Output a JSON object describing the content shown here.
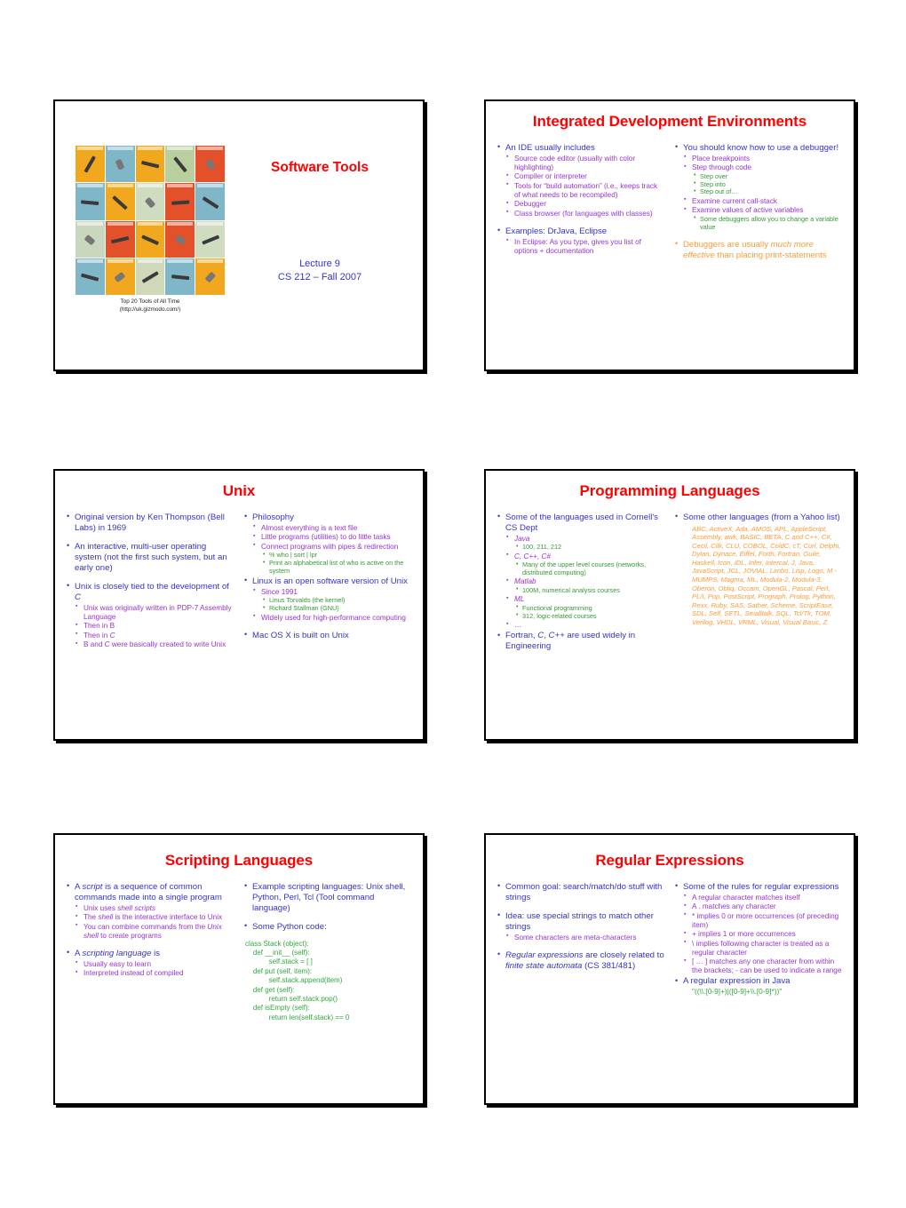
{
  "document": {
    "type": "lecture-slide-handout",
    "slide_count": 6
  },
  "colors": {
    "title_red": "#ff0000",
    "level1_blue": "#3333cc",
    "level2_purple": "#9933cc",
    "level3_green": "#339933",
    "accent_orange": "#ff9933",
    "code_green": "#2eaa3c",
    "border_black": "#000000"
  },
  "slides": [
    {
      "id": "slide-title",
      "title": "Software Tools",
      "subtitle_lines": [
        "Lecture 9",
        "CS 212 – Fall 2007"
      ],
      "image_caption_lines": [
        "Top 20 Tools of All Time",
        "(http://uk.gizmodo.com/)"
      ],
      "image_alt": "Top 20 Tools of All Time collage, 5 by 4 grid of tool illustrations",
      "tool_grid": {
        "rows": 4,
        "cols": 5,
        "cell_colors": [
          "#f2a81e",
          "#7fb7c9",
          "#f2a81e",
          "#b9cf9e",
          "#e4502a",
          "#7fb7c9",
          "#f2a81e",
          "#cfdcc0",
          "#e4502a",
          "#7fb7c9",
          "#c9d7bf",
          "#e4502a",
          "#f2a81e",
          "#e4502a",
          "#cfdcc0",
          "#7fb7c9",
          "#f2a81e",
          "#cfd8b8",
          "#7fb7c9",
          "#f2a81e"
        ]
      }
    },
    {
      "id": "slide-ide",
      "title": "Integrated Development Environments",
      "left_column": [
        {
          "level": 1,
          "text": "An IDE usually includes",
          "children": [
            {
              "level": 2,
              "text": "Source code editor (usually with color highlighting)"
            },
            {
              "level": 2,
              "text": "Compiler or interpreter"
            },
            {
              "level": 2,
              "text": "Tools for “build automation” (i.e., keeps track of what needs to be recompiled)"
            },
            {
              "level": 2,
              "text": "Debugger"
            },
            {
              "level": 2,
              "text": "Class browser (for languages with classes)"
            }
          ]
        },
        {
          "level": 1,
          "spaced": true,
          "text": "Examples: DrJava, Eclipse",
          "children": [
            {
              "level": 2,
              "text": "In Eclipse: As you type, gives you list of options + documentation"
            }
          ]
        }
      ],
      "right_column": [
        {
          "level": 1,
          "text": "You should know how to use a debugger!",
          "children": [
            {
              "level": 2,
              "text": "Place breakpoints"
            },
            {
              "level": 2,
              "text": "Step through code",
              "children": [
                {
                  "level": 3,
                  "text": "Step over"
                },
                {
                  "level": 3,
                  "text": "Step into"
                },
                {
                  "level": 3,
                  "text": "Step out of…"
                }
              ]
            },
            {
              "level": 2,
              "text": "Examine current call-stack"
            },
            {
              "level": 2,
              "text": "Examine values of active variables",
              "children": [
                {
                  "level": 3,
                  "text": "Some debuggers allow you to change a variable value"
                }
              ]
            }
          ]
        },
        {
          "level": 1,
          "spaced": true,
          "orange": true,
          "html": "Debuggers are usually <i>much more effective</i> than placing print-statements",
          "text": "Debuggers are usually much more effective than placing print-statements"
        }
      ]
    },
    {
      "id": "slide-unix",
      "title": "Unix",
      "left_column": [
        {
          "level": 1,
          "text": "Original version by Ken Thompson (Bell Labs) in 1969"
        },
        {
          "level": 1,
          "spaced": true,
          "text": "An interactive, multi-user operating system (not the first such system, but an early one)"
        },
        {
          "level": 1,
          "spaced": true,
          "html": "Unix is closely tied to the development of <i>C</i>",
          "text": "Unix is closely tied to the development of C",
          "children": [
            {
              "level": 2,
              "text": "Unix was originally written in PDP-7 Assembly Language"
            },
            {
              "level": 2,
              "text": "Then in B"
            },
            {
              "level": 2,
              "html": "Then in <i>C</i>",
              "text": "Then in C"
            },
            {
              "level": 2,
              "html": "B and <i>C</i> were basically created to write Unix",
              "text": "B and C were basically created to write Unix"
            }
          ]
        }
      ],
      "right_column": [
        {
          "level": 1,
          "text": "Philosophy",
          "children": [
            {
              "level": 2,
              "text": "Almost everything is a text file"
            },
            {
              "level": 2,
              "text": "Little programs (utilities) to do little tasks"
            },
            {
              "level": 2,
              "text": "Connect programs with pipes & redirection",
              "children": [
                {
                  "level": 3,
                  "text": "% who | sort | lpr"
                },
                {
                  "level": 3,
                  "text": "Print an alphabetical list of who is active on the system"
                }
              ]
            }
          ]
        },
        {
          "level": 1,
          "text": "Linux is an open software version of Unix",
          "children": [
            {
              "level": 2,
              "text": "Since 1991",
              "children": [
                {
                  "level": 3,
                  "text": "Linus Torvalds (the kernel)"
                },
                {
                  "level": 3,
                  "text": "Richard Stallman (GNU)"
                }
              ]
            },
            {
              "level": 2,
              "text": "Widely used for high-performance computing"
            }
          ]
        },
        {
          "level": 1,
          "spaced": true,
          "text": "Mac OS X is built on Unix"
        }
      ]
    },
    {
      "id": "slide-prog-langs",
      "title": "Programming Languages",
      "left_column": [
        {
          "level": 1,
          "text": "Some of the languages used in Cornell's CS Dept",
          "children": [
            {
              "level": 2,
              "html": "<i>Java</i>",
              "text": "Java",
              "children": [
                {
                  "level": 3,
                  "text": "100, 211, 212"
                }
              ]
            },
            {
              "level": 2,
              "html": "<i>C, C++, C#</i>",
              "text": "C, C++, C#",
              "children": [
                {
                  "level": 3,
                  "text": "Many of the upper level courses (networks, distributed computing)"
                }
              ]
            },
            {
              "level": 2,
              "html": "<i>Matlab</i>",
              "text": "Matlab",
              "children": [
                {
                  "level": 3,
                  "text": "100M, numerical analysis courses"
                }
              ]
            },
            {
              "level": 2,
              "html": "<i>ML</i>",
              "text": "ML",
              "children": [
                {
                  "level": 3,
                  "text": "Functional programming"
                },
                {
                  "level": 3,
                  "text": "312, logic-related courses"
                }
              ]
            },
            {
              "level": 2,
              "text": "…"
            }
          ]
        },
        {
          "level": 1,
          "html": "Fortran, <i>C</i>, <i>C++</i> are used widely in Engineering",
          "text": "Fortran, C, C++ are used widely in Engineering"
        }
      ],
      "right_column": [
        {
          "level": 1,
          "text": "Some other languages (from a Yahoo list)",
          "plain_text": "ABC, ActiveX, Ada, AMOS, APL, AppleScript, Assembly, awk, BASIC, BETA, C and C++, C#, Cecil, Cilk, CLU, COBOL, ColdC, cT, Curl, Delphi, Dylan, Dynace, Eiffel, Forth, Fortran, Guile, Haskell, Icon, IDL, Infer, Intercal, J, Java, JavaScript, JCL, JOVIAL, Limbo, Lisp, Logo, M - MUMPS, Magma, ML, Modula-2, Modula-3, Oberon, Obliq, Occam, OpenGL, Pascal, Perl, PL/I, Pop, PostScript, Prograph, Prolog, Python, Rexx, Ruby, SAS, Sather, Scheme, ScriptEase, SDL, Self, SETL, Smalltalk, SQL, Tcl/Tk, TOM, Verilog, VHDL, VRML, Visual, Visual Basic, Z"
        }
      ]
    },
    {
      "id": "slide-scripting",
      "title": "Scripting Languages",
      "left_column": [
        {
          "level": 1,
          "html": "A <i>script</i> is a sequence of common commands made into a single program",
          "text": "A script is a sequence of common commands made into a single program",
          "children": [
            {
              "level": 2,
              "html": "Unix uses <i>shell scripts</i>",
              "text": "Unix uses shell scripts"
            },
            {
              "level": 2,
              "html": "The <i>shell</i> is the interactive interface to Unix",
              "text": "The shell is the interactive interface to Unix"
            },
            {
              "level": 2,
              "html": "You can combine commands from the <i>Unix shell</i> to create programs",
              "text": "You can combine commands from the Unix shell to create programs"
            }
          ]
        },
        {
          "level": 1,
          "spaced": true,
          "html": "A <i>scripting language</i> is",
          "text": "A scripting language is",
          "children": [
            {
              "level": 2,
              "text": "Usually easy to learn"
            },
            {
              "level": 2,
              "text": "Interpreted instead of compiled"
            }
          ]
        }
      ],
      "right_column": [
        {
          "level": 1,
          "text": "Example scripting languages: Unix shell, Python, Perl, Tcl (Tool command language)"
        },
        {
          "level": 1,
          "spaced": true,
          "text": "Some Python code:"
        }
      ],
      "code": "class Stack (object):\n    def __init__ (self):\n            self.stack = [ ]\n    def put (self, item):\n            self.stack.append(item)\n    def get (self):\n            return self.stack.pop()\n    def isEmpty (self):\n            return len(self.stack) == 0"
    },
    {
      "id": "slide-regex",
      "title": "Regular Expressions",
      "left_column": [
        {
          "level": 1,
          "text": "Common goal: search/match/do stuff with strings"
        },
        {
          "level": 1,
          "spaced": true,
          "text": "Idea: use special strings to match other strings",
          "children": [
            {
              "level": 2,
              "text": "Some characters are meta-characters"
            }
          ]
        },
        {
          "level": 1,
          "spaced": true,
          "html": "<i>Regular expressions</i> are closely related to <i>finite state automata</i> (CS 381/481)",
          "text": "Regular expressions are closely related to finite state automata (CS 381/481)"
        }
      ],
      "right_column": [
        {
          "level": 1,
          "text": "Some of the rules for regular expressions",
          "children": [
            {
              "level": 2,
              "text": "A regular character matches itself"
            },
            {
              "level": 2,
              "text": "A . matches any character"
            },
            {
              "level": 2,
              "text": "* implies 0 or more occurrences (of preceding item)"
            },
            {
              "level": 2,
              "text": "+ implies 1 or more occurrences"
            },
            {
              "level": 2,
              "text": "\\ implies following character is treated as a regular character"
            },
            {
              "level": 2,
              "text": "[ … ] matches any one character from within the brackets; - can be used to indicate a range"
            }
          ]
        },
        {
          "level": 1,
          "text": "A regular expression in Java"
        }
      ],
      "regex_example": "\"((\\\\.[0-9]+)|([0-9]+\\\\.[0-9]*))\""
    }
  ]
}
